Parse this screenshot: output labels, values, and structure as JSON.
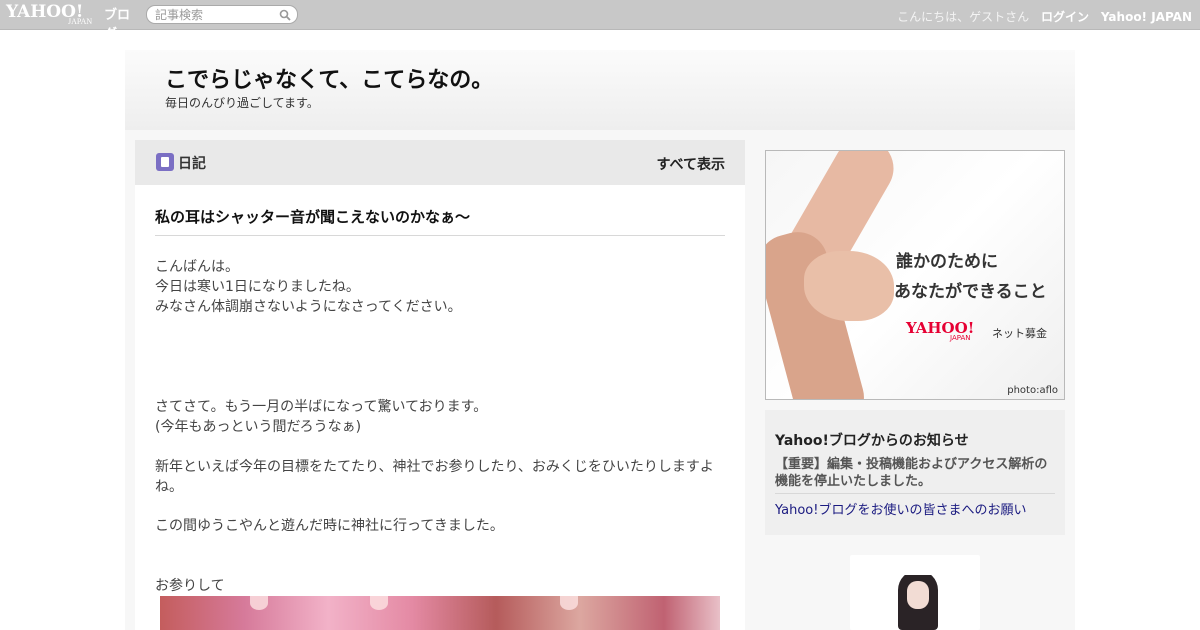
{
  "topbar": {
    "logo_text": "YAHOO!",
    "logo_sub": "JAPAN",
    "logo_blog": "ブログ",
    "search_placeholder": "記事検索",
    "greeting": "こんにちは、ゲストさん",
    "login": "ログイン",
    "yahoo_japan": "Yahoo! JAPAN"
  },
  "blog": {
    "title": "こでらじゃなくて、こてらなの。",
    "description": "毎日のんびり過ごしてます。"
  },
  "category": {
    "name": "日記",
    "show_all": "すべて表示"
  },
  "post": {
    "title": "私の耳はシャッター音が聞こえないのかなぁ～",
    "paragraphs": [
      "こんばんは。",
      "今日は寒い1日になりましたね。",
      "みなさん体調崩さないようになさってください。",
      "さてさて。もう一月の半ばになって驚いております。",
      "(今年もあっという間だろうなぁ)",
      "新年といえば今年の目標をたてたり、神社でお参りしたり、おみくじをひいたりしますよね。",
      "この間ゆうこやんと遊んだ時に神社に行ってきました。",
      "お参りして"
    ]
  },
  "ad": {
    "line1": "誰かのために",
    "line2": "あなたができること",
    "logo": "YAHOO!",
    "logo_sub": "JAPAN",
    "label": "ネット募金",
    "credit": "photo:aflo"
  },
  "notice": {
    "heading": "Yahoo!ブログからのお知らせ",
    "item1": "【重要】編集・投稿機能およびアクセス解析の機能を停止いたしました。",
    "item2": "Yahoo!ブログをお使いの皆さまへのお願い"
  }
}
